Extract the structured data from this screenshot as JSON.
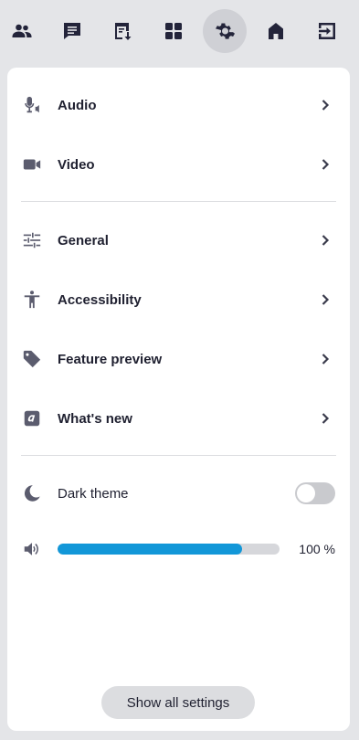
{
  "topbar": {
    "buttons": [
      {
        "icon": "people-icon"
      },
      {
        "icon": "chat-icon"
      },
      {
        "icon": "polls-download-icon"
      },
      {
        "icon": "apps-grid-icon"
      },
      {
        "icon": "gear-icon",
        "active": true
      },
      {
        "icon": "home-icon"
      },
      {
        "icon": "leave-icon"
      }
    ]
  },
  "menu": {
    "audio": "Audio",
    "video": "Video",
    "general": "General",
    "accessibility": "Accessibility",
    "feature_preview": "Feature preview",
    "whats_new": "What's new"
  },
  "dark_theme": {
    "label": "Dark theme",
    "enabled": false
  },
  "volume": {
    "level": 0.83,
    "display": "100 %"
  },
  "footer": {
    "show_all_label": "Show all settings"
  },
  "colors": {
    "accent": "#1297d8",
    "background": "#e4e5e8",
    "panel": "#ffffff",
    "icon": "#23243a"
  }
}
